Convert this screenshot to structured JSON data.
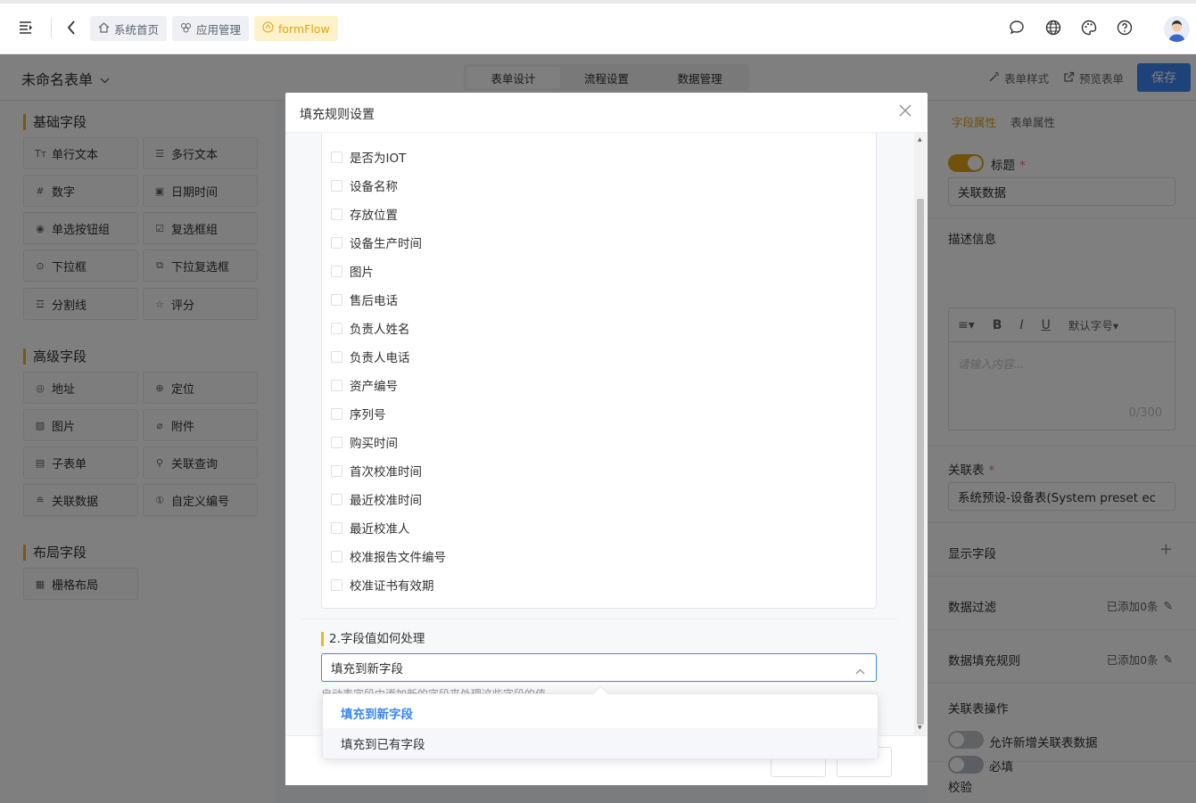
{
  "topbar": {
    "breadcrumbs": [
      {
        "label": "系统首页",
        "icon": "home-icon"
      },
      {
        "label": "应用管理",
        "icon": "apps-icon"
      },
      {
        "label": "formFlow",
        "icon": "flow-icon"
      }
    ]
  },
  "subbar": {
    "form_name": "未命名表单",
    "tabs": [
      "表单设计",
      "流程设置",
      "数据管理"
    ],
    "active_tab": "表单设计",
    "form_style": "表单样式",
    "preview": "预览表单",
    "save": "保存"
  },
  "left": {
    "groups": [
      {
        "title": "基础字段",
        "items": [
          "单行文本",
          "多行文本",
          "数字",
          "日期时间",
          "单选按钮组",
          "复选框组",
          "下拉框",
          "下拉复选框",
          "分割线",
          "评分"
        ]
      },
      {
        "title": "高级字段",
        "items": [
          "地址",
          "定位",
          "图片",
          "附件",
          "子表单",
          "关联查询",
          "关联数据",
          "自定义编号"
        ]
      },
      {
        "title": "布局字段",
        "items": [
          "栅格布局"
        ]
      }
    ]
  },
  "right": {
    "tabs": [
      "字段属性",
      "表单属性"
    ],
    "title_label": "标题",
    "title_value": "关联数据",
    "desc_label": "描述信息",
    "editor_font": "默认字号",
    "editor_placeholder": "请输入内容...",
    "editor_count": "0/300",
    "related_label": "关联表",
    "related_value": "系统预设-设备表(System preset ec",
    "display_fields": "显示字段",
    "filter_label": "数据过滤",
    "filter_status": "已添加0条",
    "fill_label": "数据填充规则",
    "fill_status": "已添加0条",
    "ops_label": "关联表操作",
    "allow_add": "允许新增关联表数据",
    "validate_label": "校验",
    "required": "必填"
  },
  "dialog": {
    "title": "填充规则设置",
    "fields": [
      "是否为IOT",
      "设备名称",
      "存放位置",
      "设备生产时间",
      "图片",
      "售后电话",
      "负责人姓名",
      "负责人电话",
      "资产编号",
      "序列号",
      "购买时间",
      "首次校准时间",
      "最近校准时间",
      "最近校准人",
      "校准报告文件编号",
      "校准证书有效期"
    ],
    "section2_title": "2.字段值如何处理",
    "select_value": "填充到新字段",
    "hint": "启动表字段中添加新的字段来处理这些字段的值"
  },
  "dropdown": {
    "options": [
      "填充到新字段",
      "填充到已有字段"
    ],
    "selected": "填充到新字段"
  },
  "colors": {
    "accent": "#e0a516",
    "primary": "#3a86f0"
  }
}
